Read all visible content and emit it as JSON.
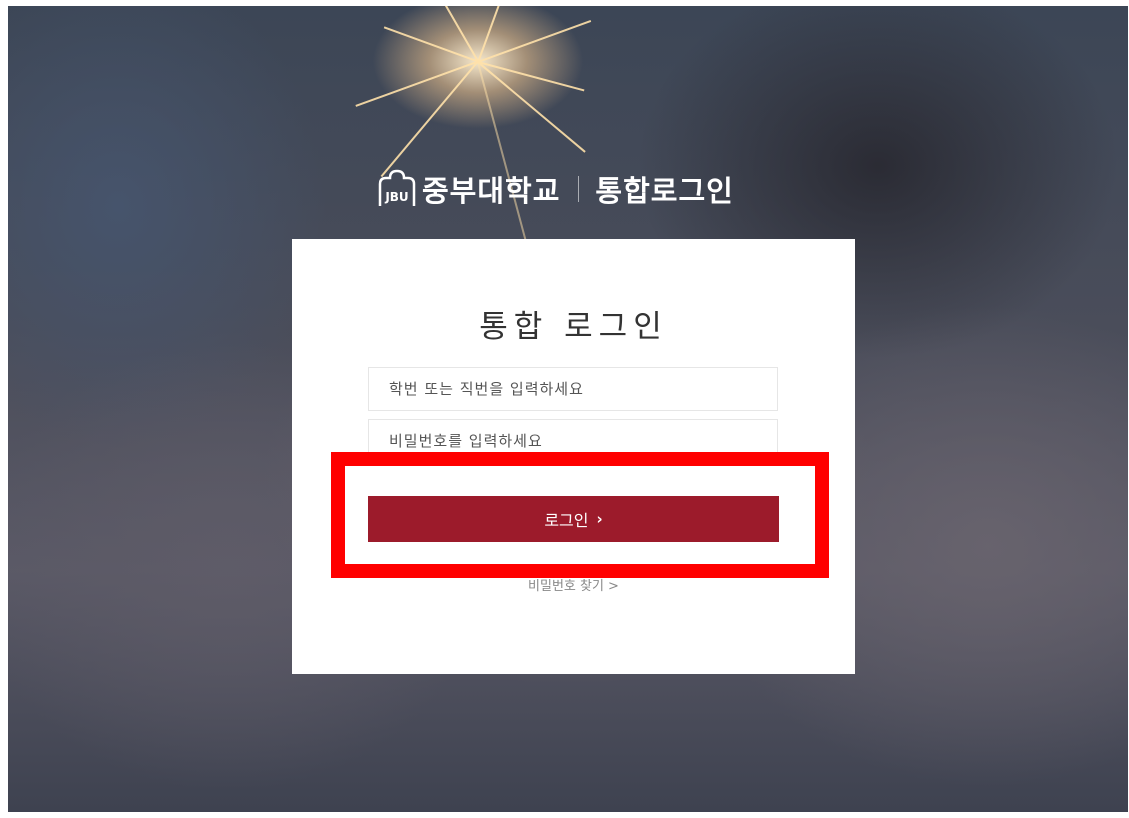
{
  "brand": {
    "university_name": "중부대학교",
    "service_name": "통합로그인",
    "logo_icon": "jbu-logo-icon"
  },
  "login": {
    "title": "통합 로그인",
    "id_placeholder": "학번 또는 직번을 입력하세요",
    "id_value": "",
    "password_placeholder": "비밀번호를 입력하세요",
    "password_value": "",
    "submit_label": "로그인",
    "submit_icon": "chevron-right-icon",
    "forgot_password_label": "비밀번호 찾기 >"
  },
  "annotation": {
    "highlight_color": "#ff0000"
  },
  "colors": {
    "primary_button": "#9c1b2b",
    "card_background": "#ffffff"
  }
}
